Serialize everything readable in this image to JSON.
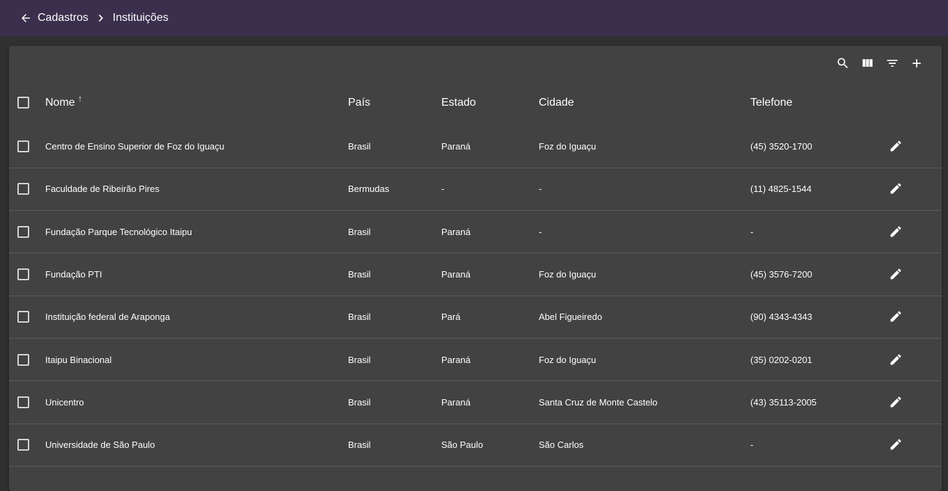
{
  "breadcrumb": {
    "parent": "Cadastros",
    "current": "Instituições"
  },
  "toolbar": {
    "icons": [
      "search-icon",
      "view-column-icon",
      "filter-list-icon",
      "add-icon"
    ]
  },
  "table": {
    "columns": {
      "nome": "Nome",
      "pais": "País",
      "estado": "Estado",
      "cidade": "Cidade",
      "telefone": "Telefone"
    },
    "sort": {
      "column": "Nome",
      "direction": "asc"
    },
    "rows": [
      {
        "nome": "Centro de Ensino Superior de Foz do Iguaçu",
        "pais": "Brasil",
        "estado": "Paraná",
        "cidade": "Foz do Iguaçu",
        "telefone": "(45) 3520-1700"
      },
      {
        "nome": "Faculdade de Ribeirão Pires",
        "pais": "Bermudas",
        "estado": "-",
        "cidade": "-",
        "telefone": "(11) 4825-1544"
      },
      {
        "nome": "Fundação Parque Tecnológico Itaipu",
        "pais": "Brasil",
        "estado": "Paraná",
        "cidade": "-",
        "telefone": "-"
      },
      {
        "nome": "Fundação PTI",
        "pais": "Brasil",
        "estado": "Paraná",
        "cidade": "Foz do Iguaçu",
        "telefone": "(45) 3576-7200"
      },
      {
        "nome": "Instituição federal de Araponga",
        "pais": "Brasil",
        "estado": "Pará",
        "cidade": "Abel Figueiredo",
        "telefone": "(90) 4343-4343"
      },
      {
        "nome": "Itaipu Binacional",
        "pais": "Brasil",
        "estado": "Paraná",
        "cidade": "Foz do Iguaçu",
        "telefone": "(35) 0202-0201"
      },
      {
        "nome": "Unicentro",
        "pais": "Brasil",
        "estado": "Paraná",
        "cidade": "Santa Cruz de Monte Castelo",
        "telefone": "(43) 35113-2005"
      },
      {
        "nome": "Universidade de São Paulo",
        "pais": "Brasil",
        "estado": "São Paulo",
        "cidade": "São Carlos",
        "telefone": "-"
      }
    ]
  },
  "colors": {
    "topbar": "#3a2f4d",
    "background": "#303030",
    "panel": "#424242",
    "divider": "#5c5c5c"
  }
}
